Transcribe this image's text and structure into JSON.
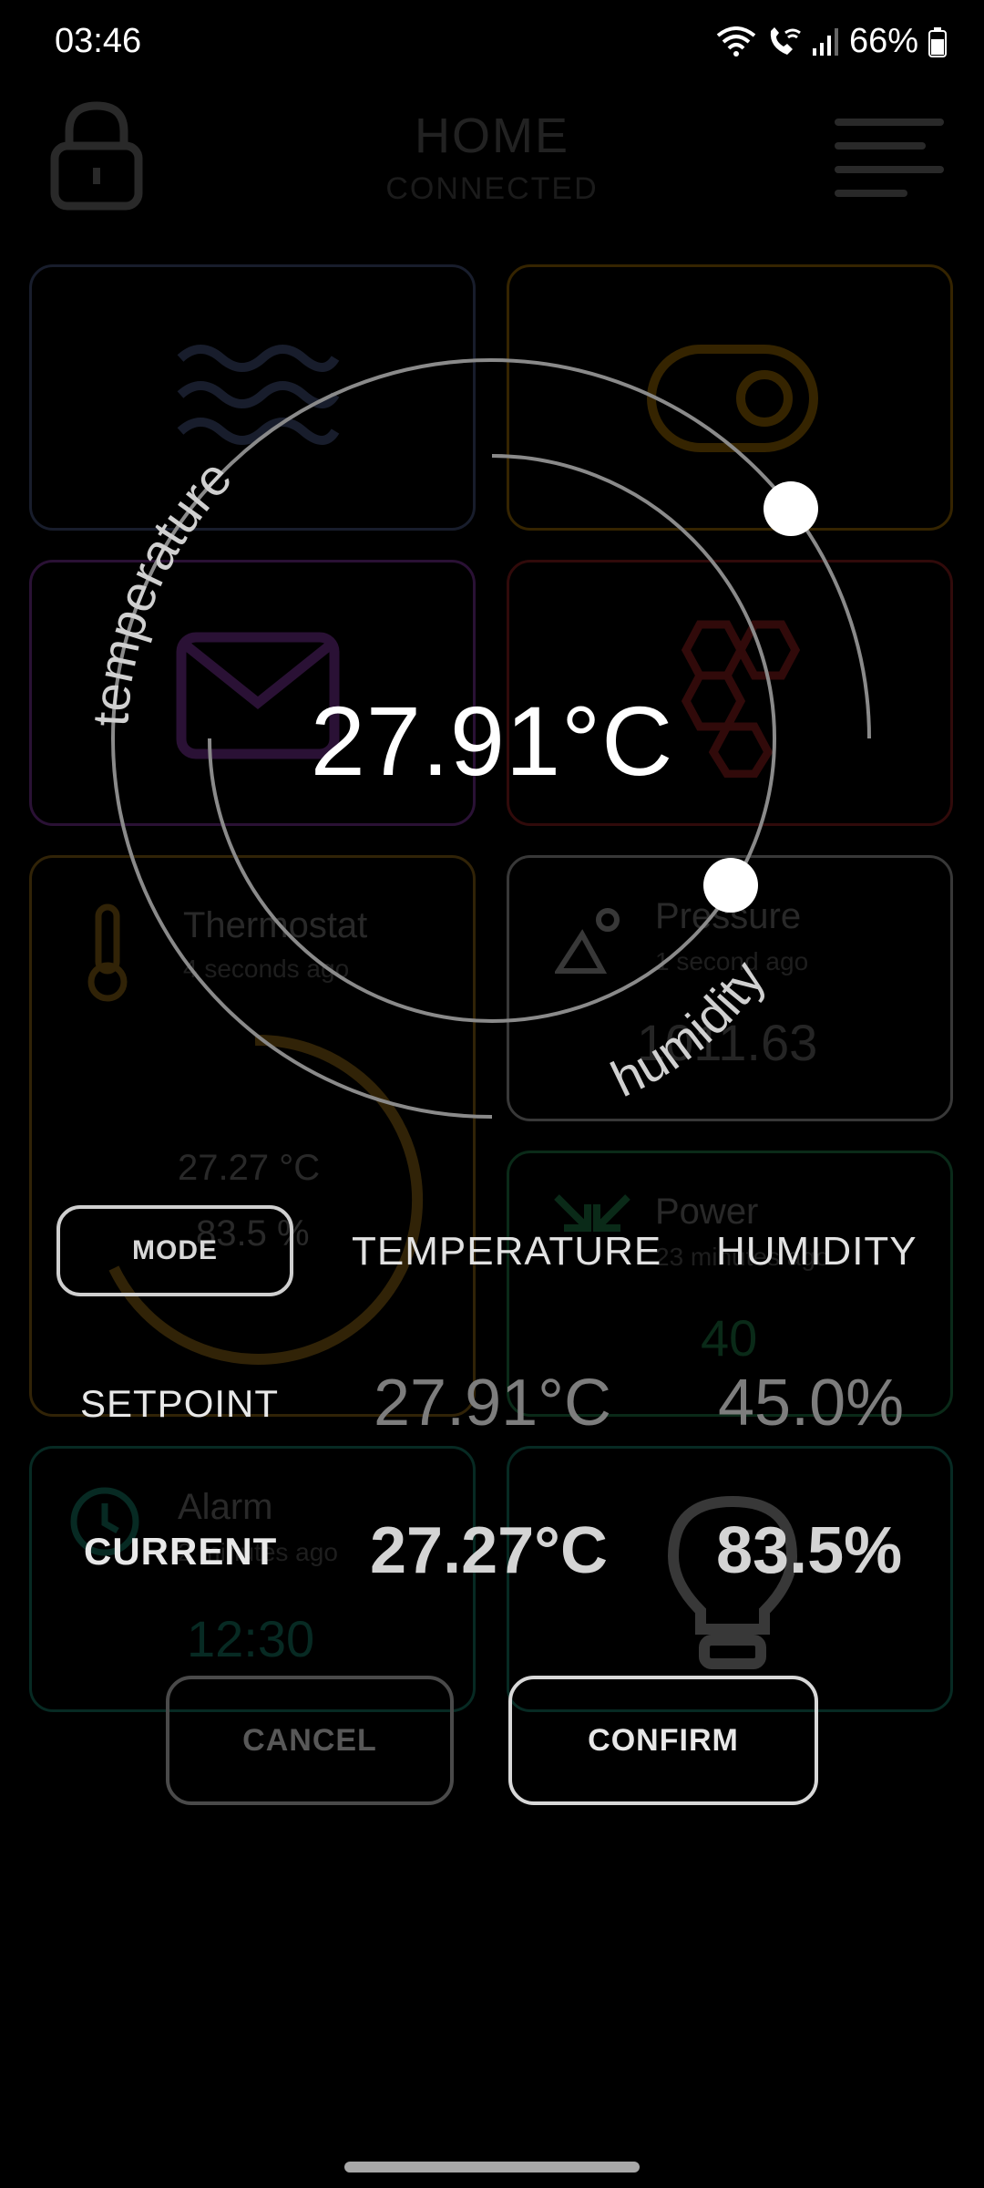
{
  "status_bar": {
    "time": "03:46",
    "battery": "66%",
    "icons": [
      "wifi-icon",
      "wifi-call-icon",
      "signal-icon",
      "battery-icon"
    ]
  },
  "header": {
    "title": "HOME",
    "subtitle": "CONNECTED",
    "lock_icon": "lock-icon",
    "menu_icon": "menu-icon"
  },
  "tiles": {
    "heater": {
      "icon": "heat-waves-icon"
    },
    "switch": {
      "icon": "toggle-icon"
    },
    "mail": {
      "icon": "mail-icon"
    },
    "hive": {
      "icon": "hexagon-icon"
    },
    "thermostat": {
      "icon": "thermometer-icon",
      "name": "Thermostat",
      "ago": "4 seconds ago",
      "temp": "27.27 °C",
      "humidity": "83.5 %"
    },
    "pressure": {
      "icon": "landscape-icon",
      "name": "Pressure",
      "ago": "1 second ago",
      "value": "1011.63"
    },
    "power": {
      "icon": "arrows-in-icon",
      "name": "Power",
      "ago": "23 minutes ago",
      "value": "40"
    },
    "alarm": {
      "icon": "clock-icon",
      "name": "Alarm",
      "ago": "2 minutes ago",
      "value": "12:30"
    },
    "light": {
      "icon": "lightbulb-icon"
    }
  },
  "dial": {
    "temperature_label": "temperature",
    "humidity_label": "humidity",
    "readout": "27.91°C",
    "temperature_level": 0.58,
    "humidity_level": 0.45
  },
  "table": {
    "mode_label": "MODE",
    "col_temperature": "TEMPERATURE",
    "col_humidity": "HUMIDITY",
    "setpoint_label": "SETPOINT",
    "setpoint_temperature": "27.91°C",
    "setpoint_humidity": "45.0%",
    "current_label": "CURRENT",
    "current_temperature": "27.27°C",
    "current_humidity": "83.5%"
  },
  "actions": {
    "cancel": "CANCEL",
    "confirm": "CONFIRM"
  },
  "colors": {
    "heater": "#6f86c7",
    "switch": "#f0a500",
    "mail": "#c050f0",
    "hive": "#e03030",
    "thermostat": "#e0a020",
    "pressure": "#ffffff",
    "power": "#2ec070",
    "alarm": "#20c0a0",
    "light": "#ffffff"
  }
}
